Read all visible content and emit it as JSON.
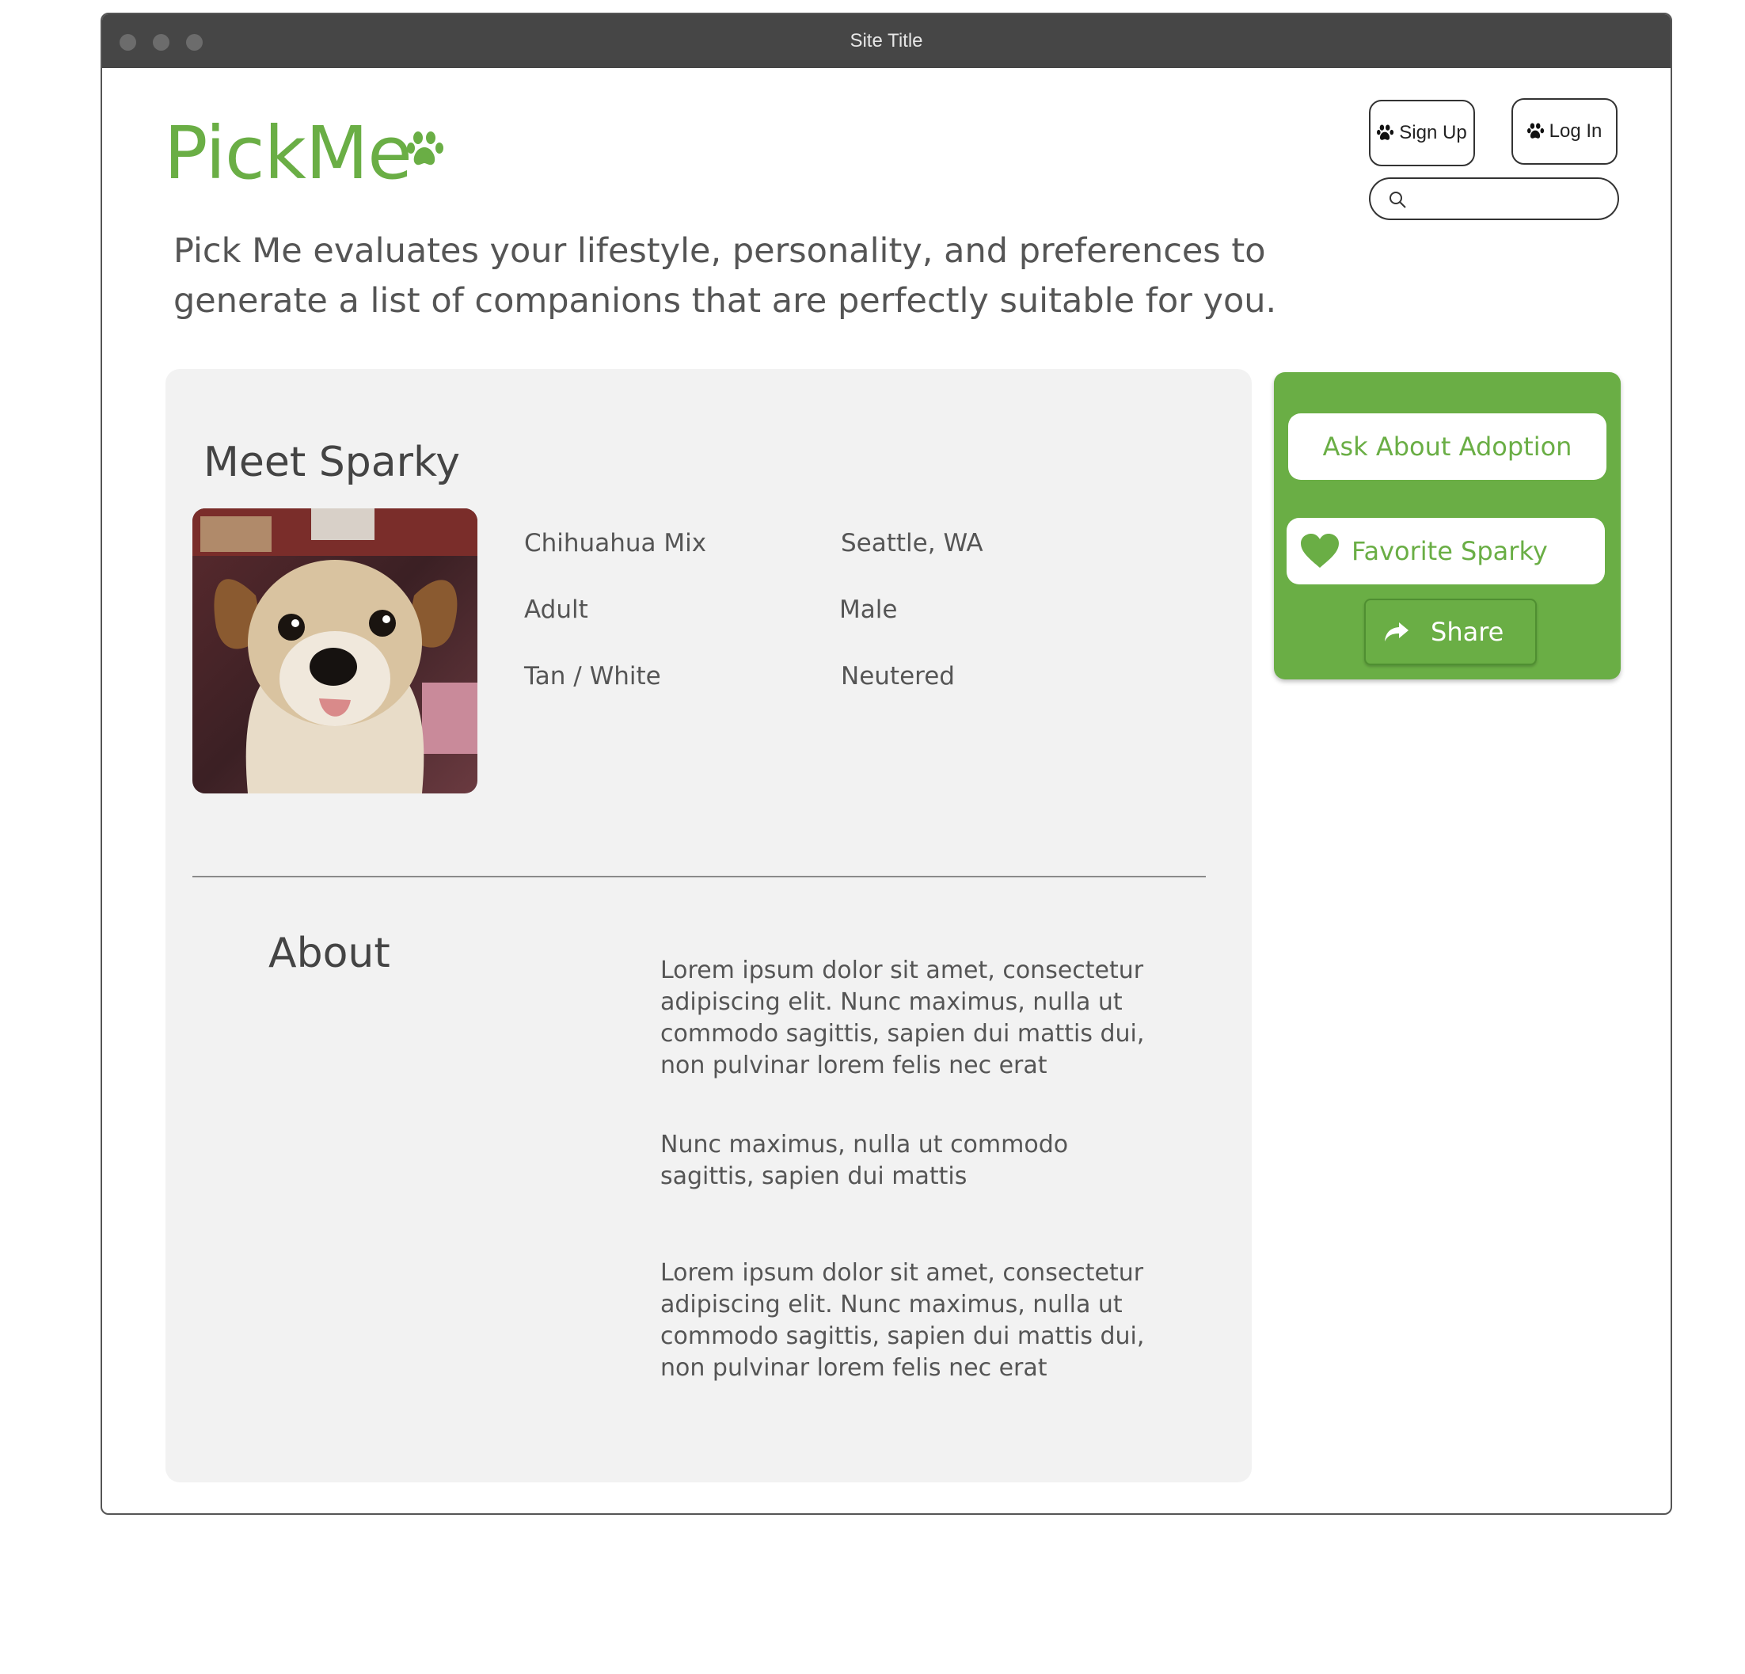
{
  "window": {
    "title": "Site Title"
  },
  "header": {
    "logo": "PickMe",
    "sign_up_label": "Sign Up",
    "log_in_label": "Log In",
    "search_placeholder": ""
  },
  "tagline": "Pick Me evaluates your lifestyle, personality, and preferences to generate a list of companions that are perfectly suitable for you.",
  "pet": {
    "heading": "Meet Sparky",
    "facts": {
      "breed": "Chihuahua Mix",
      "location": "Seattle, WA",
      "age": "Adult",
      "sex": "Male",
      "color": "Tan / White",
      "status": "Neutered"
    }
  },
  "about": {
    "heading": "About",
    "paragraphs": [
      "Lorem ipsum dolor sit amet, consectetur adipiscing elit. Nunc maximus, nulla ut commodo sagittis, sapien dui mattis dui, non pulvinar lorem felis nec erat",
      "Nunc maximus, nulla ut commodo sagittis, sapien dui mattis",
      "Lorem ipsum dolor sit amet, consectetur adipiscing elit. Nunc maximus, nulla ut commodo sagittis, sapien dui mattis dui, non pulvinar lorem felis nec erat"
    ]
  },
  "actions": {
    "ask_label": "Ask About Adoption",
    "favorite_label": "Favorite Sparky",
    "share_label": "Share"
  },
  "icons": {
    "paw": "paw-icon",
    "search": "search-icon",
    "heart": "heart-icon",
    "share": "share-arrow-icon"
  },
  "colors": {
    "brand_green": "#6aae45",
    "titlebar": "#464646",
    "card_bg": "#f2f2f2"
  }
}
